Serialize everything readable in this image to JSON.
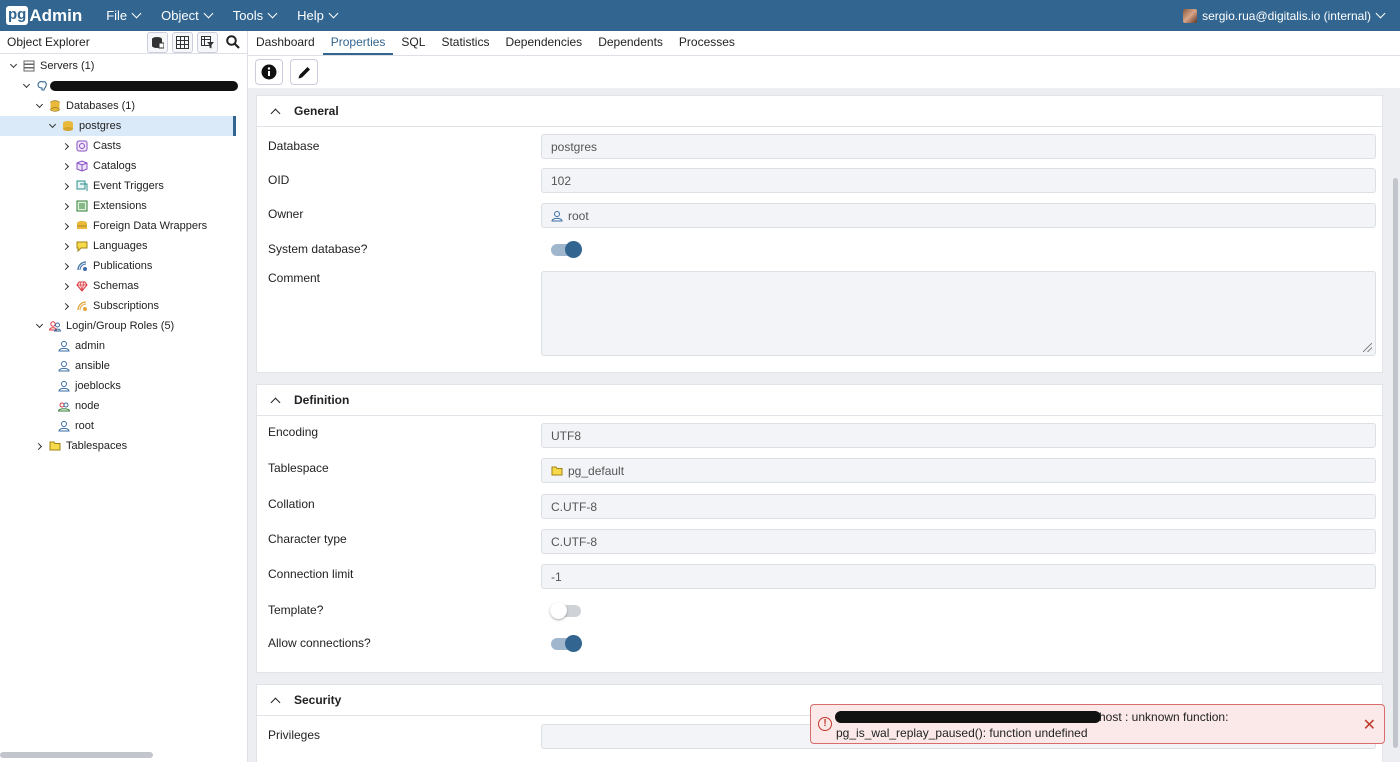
{
  "app": {
    "logo_pg": "pg",
    "logo_admin": "Admin",
    "menu": [
      "File",
      "Object",
      "Tools",
      "Help"
    ],
    "user": "sergio.rua@digitalis.io (internal)"
  },
  "explorer": {
    "title": "Object Explorer",
    "tree": [
      {
        "label": "Servers (1)"
      },
      {
        "label": ""
      },
      {
        "label": "Databases (1)"
      },
      {
        "label": "postgres"
      },
      {
        "label": "Casts"
      },
      {
        "label": "Catalogs"
      },
      {
        "label": "Event Triggers"
      },
      {
        "label": "Extensions"
      },
      {
        "label": "Foreign Data Wrappers"
      },
      {
        "label": "Languages"
      },
      {
        "label": "Publications"
      },
      {
        "label": "Schemas"
      },
      {
        "label": "Subscriptions"
      },
      {
        "label": "Login/Group Roles (5)"
      },
      {
        "label": "admin"
      },
      {
        "label": "ansible"
      },
      {
        "label": "joeblocks"
      },
      {
        "label": "node"
      },
      {
        "label": "root"
      },
      {
        "label": "Tablespaces"
      }
    ]
  },
  "tabs": [
    "Dashboard",
    "Properties",
    "SQL",
    "Statistics",
    "Dependencies",
    "Dependents",
    "Processes"
  ],
  "general": {
    "title": "General",
    "database_label": "Database",
    "database_value": "postgres",
    "oid_label": "OID",
    "oid_value": "102",
    "owner_label": "Owner",
    "owner_value": "root",
    "system_label": "System database?",
    "comment_label": "Comment"
  },
  "definition": {
    "title": "Definition",
    "encoding_label": "Encoding",
    "encoding_value": "UTF8",
    "tablespace_label": "Tablespace",
    "tablespace_value": "pg_default",
    "collation_label": "Collation",
    "collation_value": "C.UTF-8",
    "ctype_label": "Character type",
    "ctype_value": "C.UTF-8",
    "connlimit_label": "Connection limit",
    "connlimit_value": "-1",
    "template_label": "Template?",
    "allowconn_label": "Allow connections?"
  },
  "security": {
    "title": "Security",
    "privileges_label": "Privileges"
  },
  "toast": {
    "line1": "host : unknown function:",
    "line2": "pg_is_wal_replay_paused(): function undefined",
    "close": "✕"
  },
  "colors": {
    "brand": "#326690",
    "error": "#c0392b"
  }
}
